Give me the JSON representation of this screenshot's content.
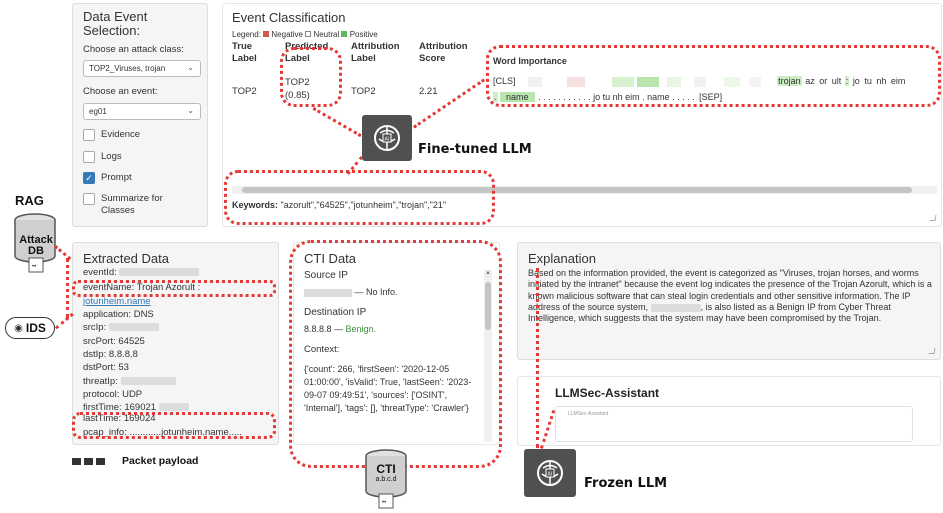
{
  "data_event_selection": {
    "title": "Data Event Selection:",
    "attack_class_label": "Choose an attack class:",
    "attack_class_value": "TOP2_Viruses, trojan",
    "event_label": "Choose an event:",
    "event_value": "eg01",
    "options": [
      {
        "label": "Evidence",
        "checked": false
      },
      {
        "label": "Logs",
        "checked": false
      },
      {
        "label": "Prompt",
        "checked": true
      },
      {
        "label": "Summarize for Classes",
        "checked": false
      }
    ]
  },
  "event_classification": {
    "title": "Event Classification",
    "legend_prefix": "Legend:",
    "legend_items": [
      {
        "label": "Negative",
        "color": "#d9534f"
      },
      {
        "label": "Neutral",
        "color": "#ffffff"
      },
      {
        "label": "Positive",
        "color": "#5cb85c"
      }
    ],
    "columns": [
      "True Label",
      "Predicted Label",
      "Attribution Label",
      "Attribution Score"
    ],
    "row": {
      "true_label": "TOP2",
      "predicted_label": "TOP2",
      "predicted_prob": "(0.85)",
      "attribution_label": "TOP2",
      "attribution_score": "2.21"
    },
    "word_importance_title": "Word Importance",
    "word_line1": [
      "trojan",
      "az",
      "or",
      "ult",
      ":",
      "jo",
      "tu",
      "nh",
      "eim"
    ],
    "word_line2_start": ".",
    "word_line2_name": "name",
    "word_line2_mid": ". . . . . . . . . . . jo tu nh eim . name . . . . .",
    "cls_token": "[CLS]",
    "sep_token": "[SEP]",
    "keywords_label": "Keywords:",
    "keywords_value": "\"azorult\",\"64525\",\"jotunheim\",\"trojan\",\"21\""
  },
  "extracted_data": {
    "title": "Extracted Data",
    "fields": [
      {
        "key": "eventId:",
        "value": ""
      },
      {
        "key": "eventName:",
        "value": "Trojan Azorult :"
      },
      {
        "key": "",
        "value": "jotunheim.name",
        "link": true
      },
      {
        "key": "application:",
        "value": "DNS"
      },
      {
        "key": "srcIp:",
        "value": ""
      },
      {
        "key": "srcPort:",
        "value": "64525"
      },
      {
        "key": "dstIp:",
        "value": "8.8.8.8"
      },
      {
        "key": "dstPort:",
        "value": "53"
      },
      {
        "key": "threatIp:",
        "value": ""
      },
      {
        "key": "protocol:",
        "value": "UDP"
      },
      {
        "key": "firstTime:",
        "value": "169021"
      },
      {
        "key": "lastTime:",
        "value": "169024"
      },
      {
        "key": "pcap_info:",
        "value": "............jotunheim.name....."
      }
    ]
  },
  "cti_data": {
    "title": "CTI Data",
    "source_ip_label": "Source IP",
    "source_ip_value": "— No Info.",
    "dest_ip_label": "Destination IP",
    "dest_ip_value": "8.8.8.8 —",
    "dest_ip_status": "Benign.",
    "context_label": "Context:",
    "context_value": "{'count': 266, 'firstSeen': '2020-12-05 01:00:00', 'isValid': True, 'lastSeen': '2023-09-07 09:49:51', 'sources': ['OSINT', 'Internal'], 'tags': [], 'threatType': 'Crawler'}"
  },
  "explanation": {
    "title": "Explanation",
    "text_part1": "Based on the information provided, the event is categorized as \"Viruses, trojan horses, and worms initiated by the intranet\" because the event log indicates the presence of the Trojan Azorult, which is a known malicious software that can steal login credentials and other sensitive information. The IP address of the source system,",
    "text_part2": "is also listed as a Benign IP from Cyber Threat Intelligence, which suggests that the system may have been compromised by the Trojan."
  },
  "assistant": {
    "title": "LLMSec-Assistant",
    "tab_label": "LLMSec-Assistant"
  },
  "annotations": {
    "rag": "RAG",
    "attack_db": "Attack DB",
    "ids": "IDS",
    "fine_tuned_llm": "Fine-tuned LLM",
    "frozen_llm": "Frozen LLM",
    "packet_payload": "Packet payload",
    "cti_db": "CTI",
    "cti_db_sub": "a.b.c.d"
  },
  "colors": {
    "annotation_red": "#e53935",
    "positive_green": "#5cb85c",
    "checkbox_blue": "#337ab7",
    "link_blue": "#337ab7"
  }
}
